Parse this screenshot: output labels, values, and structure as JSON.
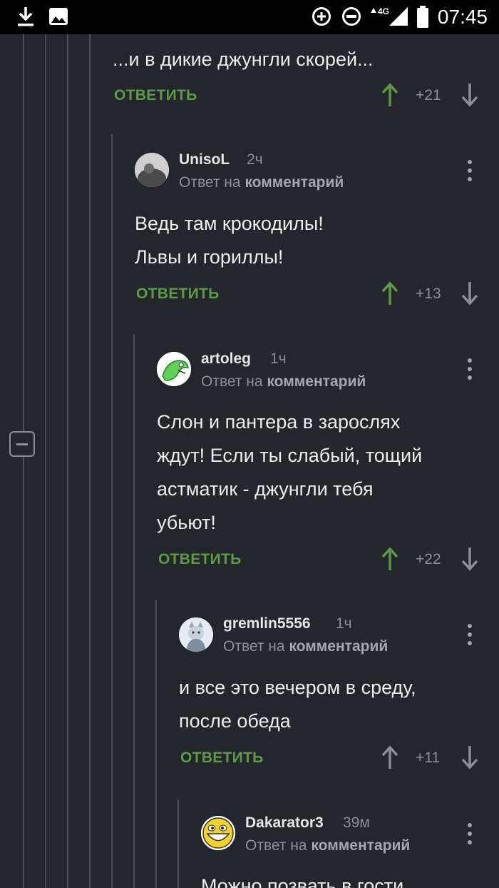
{
  "status_bar": {
    "time": "07:45",
    "network": "4G",
    "icons": [
      "download-icon",
      "image-icon",
      "data-saver-icon",
      "do-not-disturb-icon",
      "signal-icon",
      "battery-icon"
    ]
  },
  "colors": {
    "background": "#23262b",
    "reply": "#5e9a45",
    "upvoted": "#5e9a45",
    "neutral": "#8c8f95"
  },
  "top_comment": {
    "text": "...и в дикие джунгли скорей...",
    "reply_label": "ОТВЕТИТЬ",
    "rating": "+21",
    "upvoted": true
  },
  "comments": [
    {
      "username": "UnisoL",
      "time": "2ч",
      "reply_prefix": "Ответ на",
      "reply_target": "комментарий",
      "lines": [
        "Ведь там крокодилы!",
        "Львы и гориллы!"
      ],
      "reply_label": "ОТВЕТИТЬ",
      "rating": "+13",
      "upvoted": true
    },
    {
      "username": "artoleg",
      "time": "1ч",
      "reply_prefix": "Ответ на",
      "reply_target": "комментарий",
      "lines": [
        "Слон и пантера в зарослях",
        "ждут! Если ты слабый, тощий",
        "астматик - джунгли тебя",
        "убьют!"
      ],
      "reply_label": "ОТВЕТИТЬ",
      "rating": "+22",
      "upvoted": true
    },
    {
      "username": "gremlin5556",
      "time": "1ч",
      "reply_prefix": "Ответ на",
      "reply_target": "комментарий",
      "lines": [
        "и все это вечером в среду,",
        "после обеда"
      ],
      "reply_label": "ОТВЕТИТЬ",
      "rating": "+11",
      "upvoted": false
    },
    {
      "username": "Dakarator3",
      "time": "39м",
      "reply_prefix": "Ответ на",
      "reply_target": "комментарий",
      "lines": [
        "Можно позвать в гости"
      ]
    }
  ]
}
